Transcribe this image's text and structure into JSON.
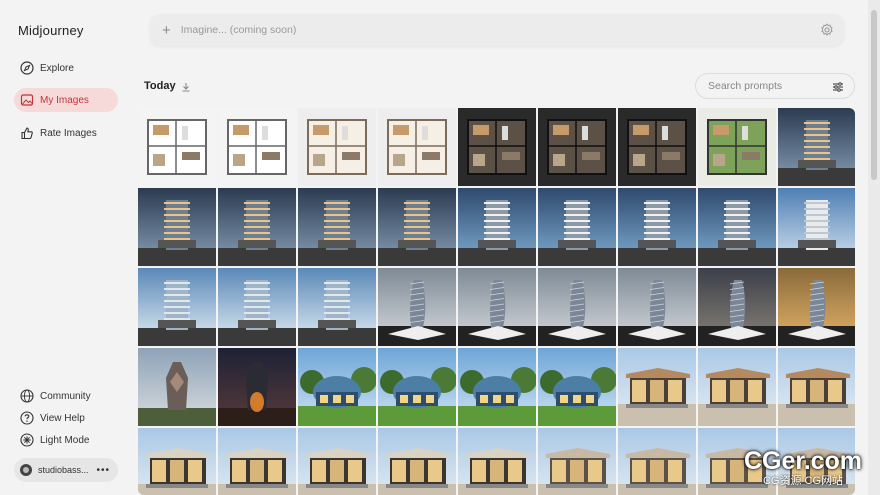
{
  "app": {
    "title": "Midjourney"
  },
  "sidebar": {
    "items": [
      {
        "label": "Explore",
        "icon": "compass-icon",
        "active": false
      },
      {
        "label": "My Images",
        "icon": "image-icon",
        "active": true
      },
      {
        "label": "Rate Images",
        "icon": "thumbs-up-icon",
        "active": false
      }
    ],
    "bottom_items": [
      {
        "label": "Community",
        "icon": "globe-icon"
      },
      {
        "label": "View Help",
        "icon": "help-icon"
      },
      {
        "label": "Light Mode",
        "icon": "sun-icon"
      }
    ],
    "user": {
      "name": "studiobass...",
      "more": "•••"
    }
  },
  "imagine": {
    "placeholder": "Imagine... (coming soon)"
  },
  "gallery": {
    "section_title": "Today",
    "search_placeholder": "Search prompts",
    "rows": [
      [
        "floorplan-light",
        "floorplan-light",
        "floorplan-3d",
        "floorplan-3d",
        "floorplan-dark",
        "floorplan-dark",
        "floorplan-dark",
        "floorplan-green",
        "tower-dusk"
      ],
      [
        "tower-dusk",
        "tower-dusk",
        "tower-dusk",
        "tower-dusk",
        "tower-blue",
        "tower-blue",
        "tower-blue",
        "tower-blue",
        "tower-white"
      ],
      [
        "skyscraper-glass",
        "skyscraper-glass",
        "skyscraper-glass",
        "tower-twisted",
        "tower-twisted",
        "tower-twisted",
        "tower-twisted",
        "tower-dark-sky",
        "tower-sunset"
      ],
      [
        "tower-sculpture",
        "tower-fire",
        "villa-blue",
        "villa-blue",
        "villa-blue",
        "villa-blue",
        "pavilion-wood",
        "pavilion-wood",
        "pavilion-wood"
      ],
      [
        "cabin-wood",
        "cabin-wood",
        "cabin-wood",
        "cabin-wood",
        "cabin-wood",
        "cabin-glass",
        "cabin-glass",
        "cabin-glass",
        "cabin-glass"
      ]
    ]
  },
  "watermark": {
    "main": "CGer.com",
    "sub": "CG资源 CG网站"
  },
  "colors": {
    "accent": "#c0363c",
    "active_bg": "#f6dada",
    "background": "#f3f3f3"
  }
}
